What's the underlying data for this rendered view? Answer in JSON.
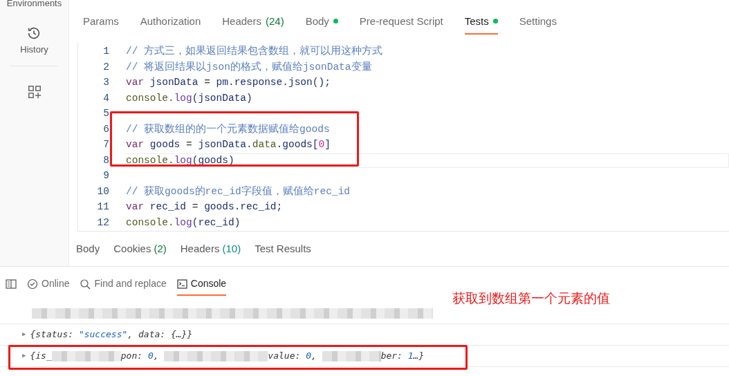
{
  "sidebar": {
    "items": [
      {
        "label": "Environments"
      },
      {
        "label": "History"
      }
    ]
  },
  "request_tabs": [
    {
      "label": "Params",
      "selected": false
    },
    {
      "label": "Authorization",
      "selected": false
    },
    {
      "label": "Headers",
      "count": "(24)",
      "selected": false
    },
    {
      "label": "Body",
      "dot": true,
      "selected": false
    },
    {
      "label": "Pre-request Script",
      "selected": false
    },
    {
      "label": "Tests",
      "dot": true,
      "selected": true
    },
    {
      "label": "Settings",
      "selected": false
    }
  ],
  "editor": {
    "lines": [
      {
        "number": "1",
        "tokens": [
          {
            "kind": "comment",
            "text": "// 方式三，如果返回结果包含数组，就可以用这种方式"
          }
        ]
      },
      {
        "number": "2",
        "tokens": [
          {
            "kind": "comment",
            "text": "// 将返回结果以json的格式，赋值给jsonData变量"
          }
        ]
      },
      {
        "number": "3",
        "tokens": [
          {
            "kind": "keyword",
            "text": "var "
          },
          {
            "kind": "name",
            "text": "jsonData"
          },
          {
            "kind": "plain",
            "text": " = "
          },
          {
            "kind": "name",
            "text": "pm.response.json();"
          }
        ]
      },
      {
        "number": "4",
        "tokens": [
          {
            "kind": "builtin",
            "text": "console."
          },
          {
            "kind": "func",
            "text": "log"
          },
          {
            "kind": "name",
            "text": "(jsonData)"
          }
        ]
      },
      {
        "number": "5"
      },
      {
        "number": "6",
        "tokens": [
          {
            "kind": "comment",
            "text": "// 获取数组的的一个元素数据赋值给goods"
          }
        ]
      },
      {
        "number": "7",
        "tokens": [
          {
            "kind": "keyword",
            "text": "var "
          },
          {
            "kind": "name",
            "text": "goods"
          },
          {
            "kind": "plain",
            "text": " = "
          },
          {
            "kind": "name",
            "text": "jsonData."
          },
          {
            "kind": "builtin",
            "text": "data"
          },
          {
            "kind": "name",
            "text": ".goods["
          },
          {
            "kind": "number",
            "text": "0"
          },
          {
            "kind": "name",
            "text": "]"
          }
        ]
      },
      {
        "number": "8",
        "active": true,
        "tokens": [
          {
            "kind": "builtin",
            "text": "console."
          },
          {
            "kind": "func",
            "text": "log"
          },
          {
            "kind": "name",
            "text": "(goods)"
          }
        ]
      },
      {
        "number": "9"
      },
      {
        "number": "10",
        "tokens": [
          {
            "kind": "comment",
            "text": "// 获取goods的rec_id字段值，赋值给rec_id"
          }
        ]
      },
      {
        "number": "11",
        "tokens": [
          {
            "kind": "keyword",
            "text": "var "
          },
          {
            "kind": "name",
            "text": "rec_id"
          },
          {
            "kind": "plain",
            "text": " = "
          },
          {
            "kind": "name",
            "text": "goods.rec_id;"
          }
        ]
      },
      {
        "number": "12",
        "tokens": [
          {
            "kind": "builtin",
            "text": "console."
          },
          {
            "kind": "func",
            "text": "log"
          },
          {
            "kind": "name",
            "text": "(rec_id)"
          }
        ]
      }
    ]
  },
  "response_tabs": [
    {
      "label": "Body"
    },
    {
      "label": "Cookies",
      "count": "(2)"
    },
    {
      "label": "Headers",
      "count": "(10)"
    },
    {
      "label": "Test Results"
    }
  ],
  "footer": {
    "items": [
      {
        "label": "Online",
        "selected": false
      },
      {
        "label": "Find and replace",
        "selected": false
      },
      {
        "label": "Console",
        "selected": true
      }
    ]
  },
  "console": {
    "annotation": "获取到数组第一个元素的值",
    "rows": [
      {
        "segments": [
          {
            "kind": "redacted"
          }
        ]
      },
      {
        "marker": "▶",
        "segments": [
          {
            "kind": "text",
            "text": "{status: "
          },
          {
            "kind": "string",
            "text": "\"success\""
          },
          {
            "kind": "text",
            "text": ", data: {…}}"
          }
        ]
      },
      {
        "highlighted": true,
        "marker": "▶",
        "segments": [
          {
            "kind": "text",
            "text": "{is_"
          },
          {
            "kind": "redacted"
          },
          {
            "kind": "text",
            "text": "pon: "
          },
          {
            "kind": "number",
            "text": "0"
          },
          {
            "kind": "text",
            "text": ", "
          },
          {
            "kind": "redacted"
          },
          {
            "kind": "text",
            "text": "value: "
          },
          {
            "kind": "number",
            "text": "0"
          },
          {
            "kind": "text",
            "text": ", "
          },
          {
            "kind": "redacted"
          },
          {
            "kind": "text",
            "text": "ber: "
          },
          {
            "kind": "number",
            "text": "1"
          },
          {
            "kind": "text",
            "text": "…}"
          }
        ]
      }
    ]
  }
}
